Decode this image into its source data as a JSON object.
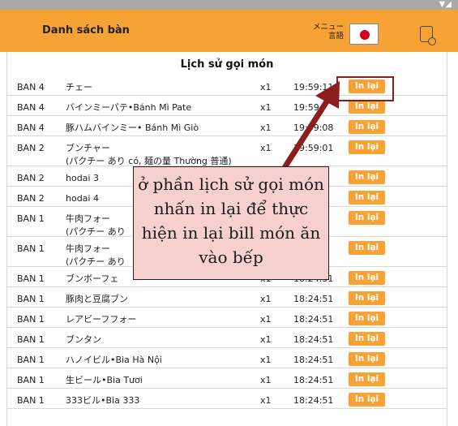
{
  "app_title": "Danh sách bàn",
  "menu_label": "メニュー",
  "lang_label": "言語",
  "section_title": "Lịch sử gọi món",
  "reprint_label": "In lại",
  "callout_text": "ở phần lịch sử gọi món nhấn in lại để thực hiện in lại bill món ăn vào bếp",
  "colors": {
    "accent": "#f7a234",
    "highlight": "#8b1d1d",
    "callout_bg": "#f6cfcf"
  },
  "orders": [
    {
      "table": "BAN 4",
      "item": "チェー",
      "item_note": "",
      "qty": "x1",
      "time": "19:59:11"
    },
    {
      "table": "BAN 4",
      "item": "バインミーパテ•Bánh Mì Pate",
      "item_note": "",
      "qty": "x1",
      "time": "19:59:"
    },
    {
      "table": "BAN 4",
      "item": "豚ハムバインミー• Bánh Mì Giò",
      "item_note": "",
      "qty": "x1",
      "time": "19:59:08"
    },
    {
      "table": "BAN 2",
      "item": "ブンチャー",
      "item_note": "(パクチー あり có, 麺の量 Thường 普通)",
      "qty": "x1",
      "time": "19:59:01"
    },
    {
      "table": "BAN 2",
      "item": "hodai 3",
      "item_note": "",
      "qty": "",
      "time": ""
    },
    {
      "table": "BAN 2",
      "item": "hodai 4",
      "item_note": "",
      "qty": "",
      "time": ""
    },
    {
      "table": "BAN 1",
      "item": "牛肉フォー",
      "item_note": "(パクチー あり",
      "qty": "",
      "time": ""
    },
    {
      "table": "BAN 1",
      "item": "牛肉フォー",
      "item_note": "(パクチー あり",
      "qty": "",
      "time": ""
    },
    {
      "table": "BAN 1",
      "item": "ブンボーフェ",
      "item_note": "",
      "qty": "x1",
      "time": "18:24:51"
    },
    {
      "table": "BAN 1",
      "item": "豚肉と豆腐ブン",
      "item_note": "",
      "qty": "x1",
      "time": "18:24:51"
    },
    {
      "table": "BAN 1",
      "item": "レアビーフフォー",
      "item_note": "",
      "qty": "x1",
      "time": "18:24:51"
    },
    {
      "table": "BAN 1",
      "item": "ブンタン",
      "item_note": "",
      "qty": "x1",
      "time": "18:24:51"
    },
    {
      "table": "BAN 1",
      "item": "ハノイビル•Bia Hà Nội",
      "item_note": "",
      "qty": "x1",
      "time": "18:24:51"
    },
    {
      "table": "BAN 1",
      "item": "生ビール•Bia Tươi",
      "item_note": "",
      "qty": "x1",
      "time": "18:24:51"
    },
    {
      "table": "BAN 1",
      "item": "333ビル•Bia 333",
      "item_note": "",
      "qty": "x1",
      "time": "18:24:51"
    }
  ]
}
